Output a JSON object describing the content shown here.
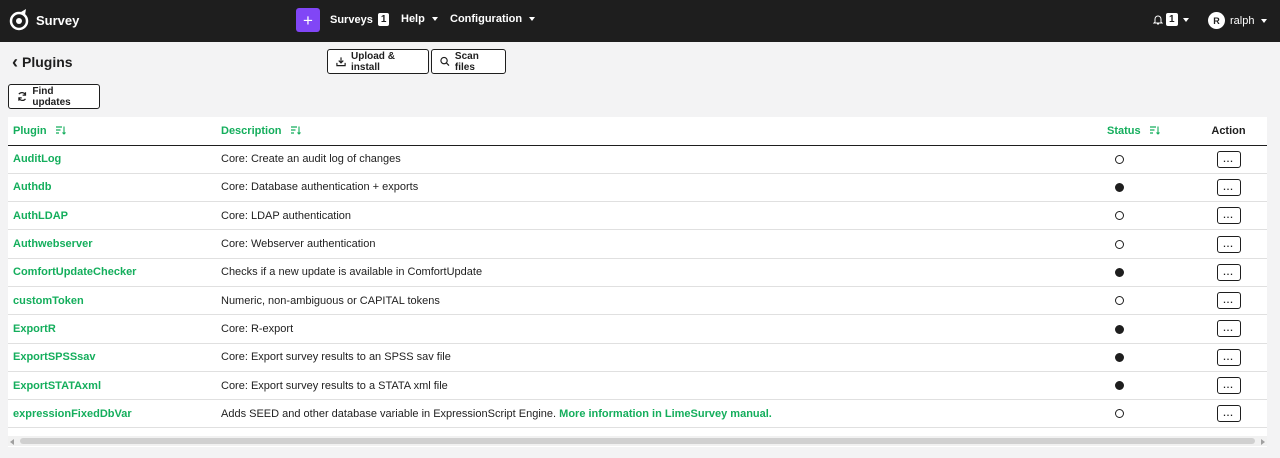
{
  "nav": {
    "brand": "Survey",
    "create_label": "+",
    "surveys_label": "Surveys",
    "surveys_count": "1",
    "help_label": "Help",
    "config_label": "Configuration",
    "notifications_count": "1",
    "user_initial": "R",
    "user_name": "ralph"
  },
  "toolbar": {
    "back_glyph": "‹",
    "title": "Plugins",
    "upload_label": "Upload & install",
    "scan_label": "Scan files",
    "find_updates_label": "Find updates"
  },
  "table": {
    "headers": {
      "plugin": "Plugin",
      "description": "Description",
      "status": "Status",
      "action": "Action"
    },
    "action_label": "...",
    "rows": [
      {
        "name": "AuditLog",
        "description": "Core: Create an audit log of changes",
        "link": "",
        "active": false
      },
      {
        "name": "Authdb",
        "description": "Core: Database authentication + exports",
        "link": "",
        "active": true
      },
      {
        "name": "AuthLDAP",
        "description": "Core: LDAP authentication",
        "link": "",
        "active": false
      },
      {
        "name": "Authwebserver",
        "description": "Core: Webserver authentication",
        "link": "",
        "active": false
      },
      {
        "name": "ComfortUpdateChecker",
        "description": "Checks if a new update is available in ComfortUpdate",
        "link": "",
        "active": true
      },
      {
        "name": "customToken",
        "description": "Numeric, non-ambiguous or CAPITAL tokens",
        "link": "",
        "active": false
      },
      {
        "name": "ExportR",
        "description": "Core: R-export",
        "link": "",
        "active": true
      },
      {
        "name": "ExportSPSSsav",
        "description": "Core: Export survey results to an SPSS sav file",
        "link": "",
        "active": true
      },
      {
        "name": "ExportSTATAxml",
        "description": "Core: Export survey results to a STATA xml file",
        "link": "",
        "active": true
      },
      {
        "name": "expressionFixedDbVar",
        "description": "Adds SEED and other database variable in ExpressionScript Engine.",
        "link": "More information in LimeSurvey manual.",
        "active": false
      }
    ]
  },
  "colors": {
    "accent": "#14ae5c",
    "nav_bg": "#1e1e1e",
    "create": "#8146f6"
  }
}
